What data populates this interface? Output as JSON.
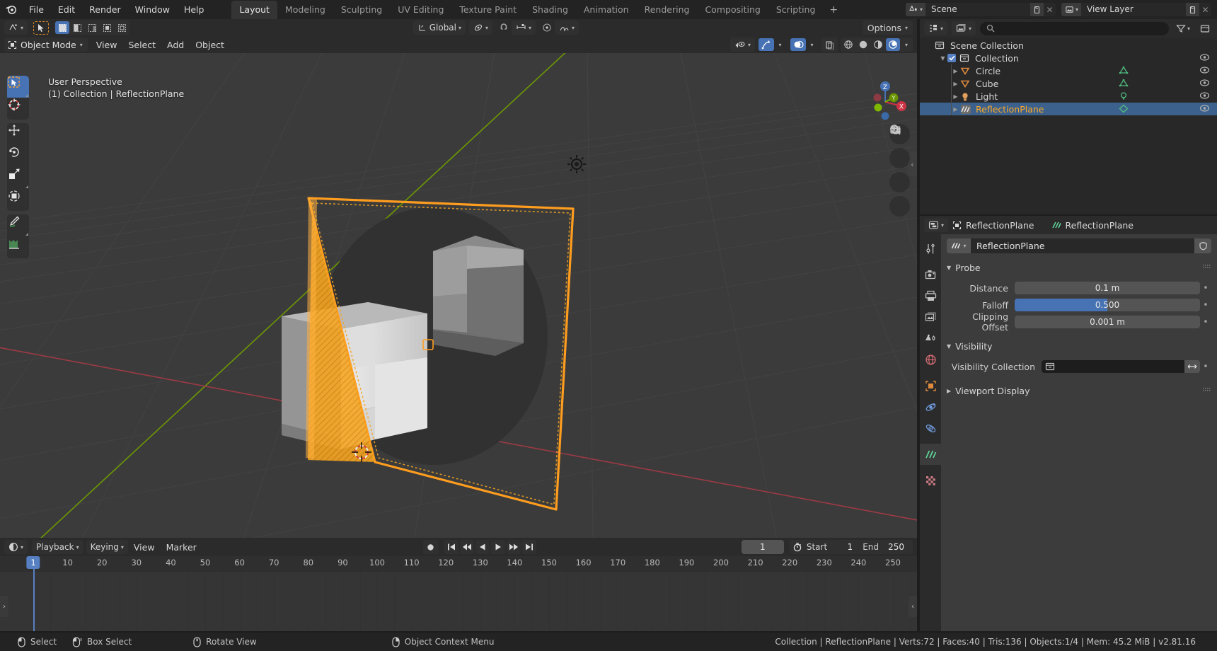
{
  "topbar": {
    "logo_icon": "blender-logo-icon",
    "menus": [
      "File",
      "Edit",
      "Render",
      "Window",
      "Help"
    ],
    "workspace_tabs": [
      {
        "label": "Layout",
        "active": true
      },
      {
        "label": "Modeling",
        "active": false
      },
      {
        "label": "Sculpting",
        "active": false
      },
      {
        "label": "UV Editing",
        "active": false
      },
      {
        "label": "Texture Paint",
        "active": false
      },
      {
        "label": "Shading",
        "active": false
      },
      {
        "label": "Animation",
        "active": false
      },
      {
        "label": "Rendering",
        "active": false
      },
      {
        "label": "Compositing",
        "active": false
      },
      {
        "label": "Scripting",
        "active": false
      }
    ],
    "add_workspace_label": "+",
    "scene": {
      "icon": "scene-icon",
      "name": "Scene",
      "new_icon": "new-copy-icon",
      "unlink_icon": "x-icon"
    },
    "view_layer": {
      "icon": "view-layer-icon",
      "name": "View Layer",
      "new_icon": "new-copy-icon",
      "unlink_icon": "x-icon"
    }
  },
  "viewport": {
    "header": {
      "editor_type_icon": "editor-type-3dview-icon",
      "cursor_tool_icon": "tweak-select-icon",
      "select_modes": [
        "set",
        "extend",
        "subtract",
        "invert",
        "intersect"
      ],
      "transform_orientation": "Global",
      "pivot_icon": "pivot-point-icon",
      "snap_icon": "snap-magnet-icon",
      "snap_target_icon": "snap-increment-icon",
      "proportional_icon": "proportional-editing-icon",
      "falloff_icon": "proportional-falloff-icon",
      "options_label": "Options",
      "mode_label": "Object Mode",
      "menus": [
        "View",
        "Select",
        "Add",
        "Object"
      ],
      "visibility_icon": "object-visibility-icon",
      "gizmo_icon": "gizmo-icon",
      "overlays_icon": "overlays-icon",
      "xray_icon": "toggle-xray-icon",
      "shading_modes": [
        "wireframe",
        "solid",
        "material-preview",
        "rendered"
      ],
      "active_shading": "rendered"
    },
    "overlay_text_line1": "User Perspective",
    "overlay_text_line2": "(1) Collection | ReflectionPlane",
    "toolbar_tools": [
      {
        "name": "tweak-tool",
        "active": true
      },
      {
        "name": "cursor-tool",
        "active": false
      },
      {
        "name": "move-tool",
        "active": false
      },
      {
        "name": "rotate-tool",
        "active": false
      },
      {
        "name": "scale-tool",
        "active": false
      },
      {
        "name": "transform-tool",
        "active": false
      },
      {
        "name": "annotate-tool",
        "active": false
      },
      {
        "name": "measure-tool",
        "active": false
      }
    ],
    "nav_buttons": [
      "zoom-icon",
      "pan-hand-icon",
      "camera-view-icon",
      "toggle-ortho-icon"
    ],
    "gizmo_axes": [
      {
        "label": "Z",
        "color": "#4772b3"
      },
      {
        "label": "Y",
        "color": "#7fb700"
      },
      {
        "label": "X",
        "color": "#cc3344"
      }
    ],
    "sidebar_toggle_icon": "chevron-left-icon"
  },
  "timeline": {
    "editor_icon": "editor-type-timeline-icon",
    "menus": [
      "Playback",
      "Keying",
      "View",
      "Marker"
    ],
    "record_icon": "auto-keying-icon",
    "transport": [
      "jump-to-start-icon",
      "jump-to-prev-keyframe-icon",
      "play-reverse-icon",
      "play-icon",
      "jump-to-next-keyframe-icon",
      "jump-to-end-icon"
    ],
    "current_frame": "1",
    "timer_icon": "use-preview-range-icon",
    "start_label": "Start",
    "start_value": "1",
    "end_label": "End",
    "end_value": "250",
    "ruler_ticks": [
      "10",
      "20",
      "30",
      "40",
      "50",
      "60",
      "70",
      "80",
      "90",
      "100",
      "110",
      "120",
      "130",
      "140",
      "150",
      "160",
      "170",
      "180",
      "190",
      "200",
      "210",
      "220",
      "230",
      "240",
      "250"
    ],
    "playhead_label": "1"
  },
  "outliner": {
    "display_mode_icon": "outliner-display-mode-icon",
    "filter_id_icon": "outliner-id-type-icon",
    "search_icon": "search-icon",
    "search_placeholder": "",
    "filter_icon": "filter-funnel-icon",
    "new_collection_icon": "new-collection-icon",
    "rows": [
      {
        "label": "Scene Collection",
        "icon": "scene-collection-icon",
        "indent": 0,
        "selected": false,
        "has_checkbox": false,
        "disclosure": "",
        "type_icon": "",
        "eye": false
      },
      {
        "label": "Collection",
        "icon": "collection-icon",
        "indent": 1,
        "selected": false,
        "has_checkbox": true,
        "disclosure": "down",
        "type_icon": "",
        "eye": true
      },
      {
        "label": "Circle",
        "icon": "mesh-data-icon",
        "indent": 2,
        "selected": false,
        "has_checkbox": false,
        "disclosure": "right",
        "type_icon": "mesh-triangle-icon",
        "eye": true
      },
      {
        "label": "Cube",
        "icon": "mesh-data-icon",
        "indent": 2,
        "selected": false,
        "has_checkbox": false,
        "disclosure": "right",
        "type_icon": "mesh-triangle-icon",
        "eye": true
      },
      {
        "label": "Light",
        "icon": "light-icon",
        "indent": 2,
        "selected": false,
        "has_checkbox": false,
        "disclosure": "right",
        "type_icon": "light-data-icon",
        "eye": true
      },
      {
        "label": "ReflectionPlane",
        "icon": "lightprobe-plane-icon",
        "indent": 2,
        "selected": true,
        "has_checkbox": false,
        "disclosure": "right",
        "type_icon": "lightprobe-data-icon",
        "eye": true
      }
    ]
  },
  "properties": {
    "editor_icon": "editor-type-properties-icon",
    "breadcrumb": [
      {
        "icon": "object-icon",
        "label": "ReflectionPlane"
      },
      {
        "icon": "lightprobe-data-icon",
        "label": "ReflectionPlane"
      }
    ],
    "tabs": [
      {
        "name": "tool-tab",
        "active": false
      },
      {
        "name": "render-tab",
        "active": false
      },
      {
        "name": "output-tab",
        "active": false
      },
      {
        "name": "view-layer-tab",
        "active": false
      },
      {
        "name": "scene-tab",
        "active": false
      },
      {
        "name": "world-tab",
        "active": false
      },
      {
        "name": "object-tab",
        "active": false
      },
      {
        "name": "modifiers-tab",
        "active": false
      },
      {
        "name": "physics-tab",
        "active": false
      },
      {
        "name": "object-data-tab",
        "active": true
      },
      {
        "name": "texture-tab",
        "active": false
      }
    ],
    "id_block": {
      "icon": "lightprobe-data-icon",
      "name": "ReflectionPlane",
      "shield_icon": "fake-user-icon"
    },
    "panels": [
      {
        "title": "Probe",
        "open": true,
        "rows": [
          {
            "label": "Distance",
            "value": "0.1 m",
            "type": "value",
            "fill": 0,
            "animate_dot": true
          },
          {
            "label": "Falloff",
            "value": "0.500",
            "type": "slider",
            "fill": 50,
            "animate_dot": true
          },
          {
            "label": "Clipping Offset",
            "value": "0.001 m",
            "type": "value",
            "fill": 0,
            "animate_dot": true
          }
        ]
      },
      {
        "title": "Visibility",
        "open": true,
        "rows": [
          {
            "label": "Visibility Collection",
            "value": "",
            "type": "collection",
            "fill": 0,
            "animate_dot": true
          }
        ]
      },
      {
        "title": "Viewport Display",
        "open": false,
        "rows": []
      }
    ]
  },
  "statusbar": {
    "hints": [
      {
        "icon": "mouse-left-icon",
        "label": "Select"
      },
      {
        "icon": "mouse-left-drag-icon",
        "label": "Box Select"
      },
      {
        "icon": "mouse-middle-icon",
        "label": "Rotate View"
      },
      {
        "icon": "mouse-right-icon",
        "label": "Object Context Menu"
      }
    ],
    "info": "Collection | ReflectionPlane | Verts:72 | Faces:40 | Tris:136 | Objects:1/4 | Mem: 45.2 MiB | v2.81.16"
  },
  "colors": {
    "accent_blue": "#4772b3",
    "select_orange": "#ffa724",
    "axis_x": "#cc3344",
    "axis_y": "#7fb700",
    "axis_z": "#4772b3",
    "panel_bg": "#3c3c3c",
    "header_bg": "#2b2b2b"
  }
}
